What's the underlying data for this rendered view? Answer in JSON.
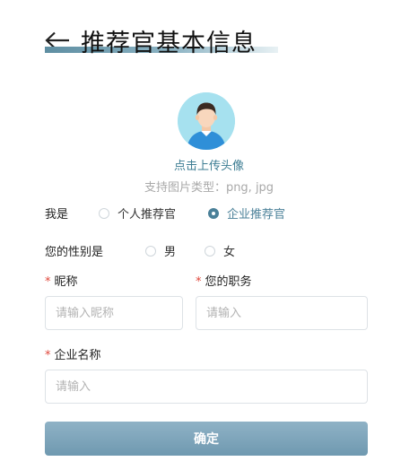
{
  "header": {
    "title": "推荐官基本信息",
    "back_icon": "arrow-left-icon"
  },
  "avatar": {
    "icon": "user-avatar-icon",
    "upload_label": "点击上传头像",
    "hint": "支持图片类型：png, jpg"
  },
  "identity": {
    "label": "我是",
    "options": [
      {
        "label": "个人推荐官",
        "selected": false
      },
      {
        "label": "企业推荐官",
        "selected": true
      }
    ]
  },
  "gender": {
    "label": "您的性别是",
    "options": [
      {
        "label": "男",
        "selected": false
      },
      {
        "label": "女",
        "selected": false
      }
    ]
  },
  "fields": {
    "required_mark": "*",
    "nickname": {
      "label": "昵称",
      "placeholder": "请输入昵称",
      "value": ""
    },
    "position": {
      "label": "您的职务",
      "placeholder": "请输入",
      "value": ""
    },
    "company": {
      "label": "企业名称",
      "placeholder": "请输入",
      "value": ""
    }
  },
  "submit": {
    "label": "确定"
  },
  "colors": {
    "accent": "#4a8098",
    "link": "#3d7d93",
    "required": "#e0463a",
    "button": "#7ea6bc",
    "avatar_bg": "#a6e1ef"
  }
}
